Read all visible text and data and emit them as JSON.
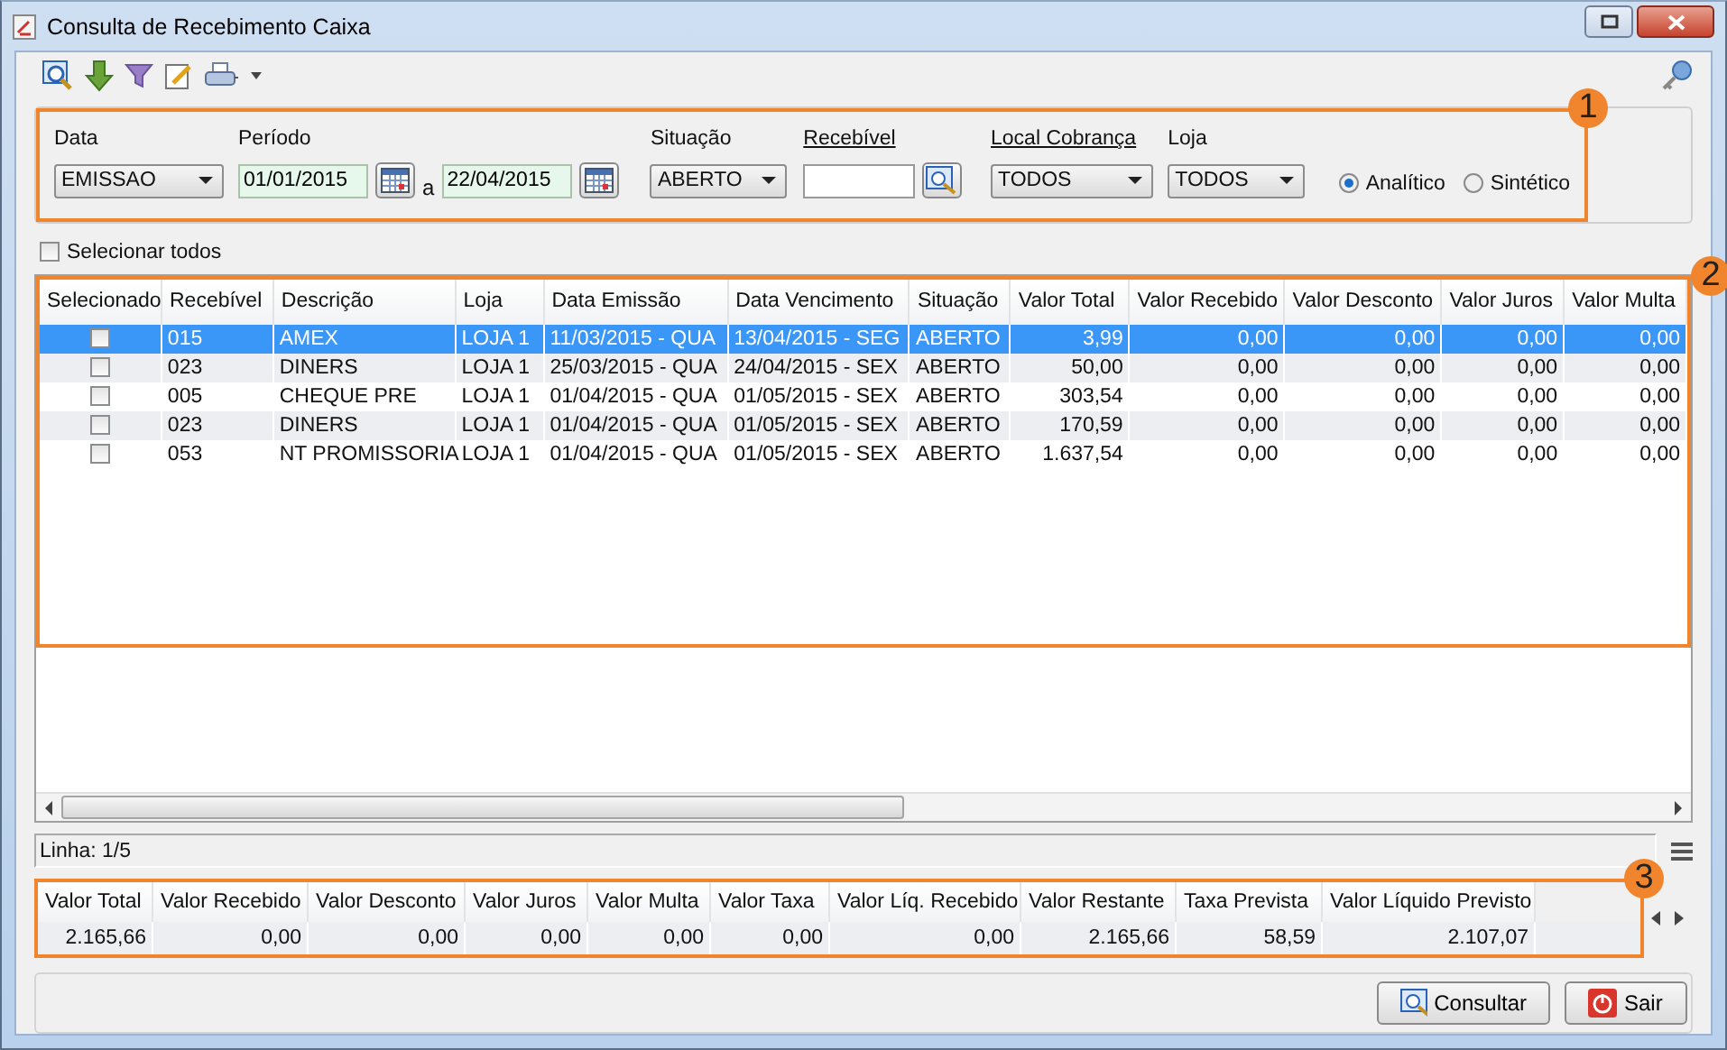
{
  "window": {
    "title": "Consulta de Recebimento Caixa"
  },
  "filters": [
    {
      "kind": "select",
      "label": "Data",
      "underlined": false,
      "value": "EMISSAO"
    },
    {
      "kind": "date_range",
      "label": "Período",
      "underlined": false,
      "from": "01/01/2015",
      "separator": "a",
      "to": "22/04/2015"
    },
    {
      "kind": "select",
      "label": "Situação",
      "underlined": false,
      "value": "ABERTO"
    },
    {
      "kind": "lookup",
      "label": "Recebível",
      "underlined": true
    },
    {
      "kind": "select",
      "label": "Local Cobrança",
      "underlined": true,
      "value": "TODOS"
    },
    {
      "kind": "select",
      "label": "Loja",
      "underlined": false,
      "value": "TODOS"
    }
  ],
  "mode": [
    {
      "label": "Analítico",
      "selected": true
    },
    {
      "label": "Sintético",
      "selected": false
    }
  ],
  "select_all": {
    "label": "Selecionar todos",
    "checked": false
  },
  "table": {
    "columns": [
      "Selecionado",
      "Recebível",
      "Descrição",
      "Loja",
      "Data Emissão",
      "Data Vencimento",
      "Situação",
      "Valor Total",
      "Valor Recebido",
      "Valor Desconto",
      "Valor Juros",
      "Valor Multa"
    ],
    "rows": [
      {
        "selected": true,
        "checked": false,
        "cells": [
          "",
          "015",
          "AMEX",
          "LOJA 1",
          "11/03/2015 - QUA",
          "13/04/2015 - SEG",
          "ABERTO",
          "3,99",
          "0,00",
          "0,00",
          "0,00",
          "0,00"
        ]
      },
      {
        "selected": false,
        "checked": false,
        "cells": [
          "",
          "023",
          "DINERS",
          "LOJA 1",
          "25/03/2015 - QUA",
          "24/04/2015 - SEX",
          "ABERTO",
          "50,00",
          "0,00",
          "0,00",
          "0,00",
          "0,00"
        ]
      },
      {
        "selected": false,
        "checked": false,
        "cells": [
          "",
          "005",
          "CHEQUE PRE",
          "LOJA 1",
          "01/04/2015 - QUA",
          "01/05/2015 - SEX",
          "ABERTO",
          "303,54",
          "0,00",
          "0,00",
          "0,00",
          "0,00"
        ]
      },
      {
        "selected": false,
        "checked": false,
        "cells": [
          "",
          "023",
          "DINERS",
          "LOJA 1",
          "01/04/2015 - QUA",
          "01/05/2015 - SEX",
          "ABERTO",
          "170,59",
          "0,00",
          "0,00",
          "0,00",
          "0,00"
        ]
      },
      {
        "selected": false,
        "checked": false,
        "cells": [
          "",
          "053",
          "NT PROMISSORIA",
          "LOJA 1",
          "01/04/2015 - QUA",
          "01/05/2015 - SEX",
          "ABERTO",
          "1.637,54",
          "0,00",
          "0,00",
          "0,00",
          "0,00"
        ]
      }
    ]
  },
  "status": "Linha: 1/5",
  "totals": {
    "columns": [
      "Valor Total",
      "Valor Recebido",
      "Valor Desconto",
      "Valor Juros",
      "Valor Multa",
      "Valor Taxa",
      "Valor Líq. Recebido",
      "Valor Restante",
      "Taxa Prevista",
      "Valor Líquido Previsto"
    ],
    "values": [
      "2.165,66",
      "0,00",
      "0,00",
      "0,00",
      "0,00",
      "0,00",
      "0,00",
      "2.165,66",
      "58,59",
      "2.107,07"
    ]
  },
  "callouts": [
    "1",
    "2",
    "3"
  ],
  "buttons": [
    {
      "kind": "search",
      "label": "Consultar"
    },
    {
      "kind": "exit",
      "label": "Sair"
    }
  ]
}
